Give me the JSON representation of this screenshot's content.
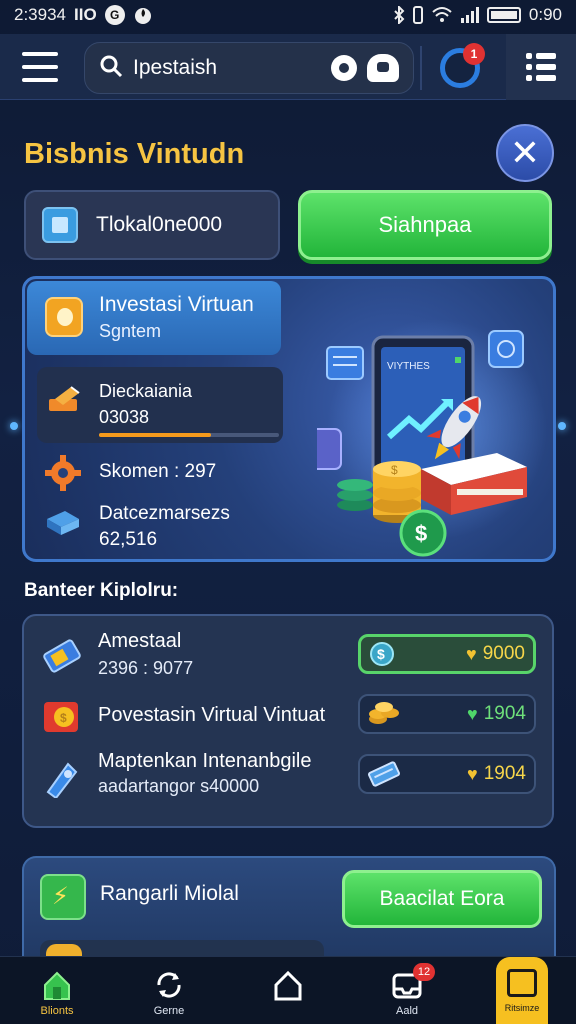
{
  "status_bar": {
    "time": "2:3934",
    "carrier": "ΙΙΟ",
    "app_glyph": "G",
    "battery_text": "0:90"
  },
  "top_bar": {
    "search_value": "Ipestaish",
    "alert_badge": "1"
  },
  "page": {
    "title": "Bisbnis Vintudn"
  },
  "balance": {
    "text": "Tlokal0ne000"
  },
  "primary_button": {
    "label": "Siahnpaa"
  },
  "hero": {
    "title": "Investasi Virtuan",
    "subtitle": "Sgntem",
    "stat_label": "Dieckaiania",
    "stat_value": "03038",
    "progress": 0.62,
    "row1_label": "Skomen : 297",
    "row2_line1": "Datcezmarsezs",
    "row2_line2": "62,516",
    "screen_label": "VIYTHES"
  },
  "section": {
    "label": "Banteer Kiplolru:"
  },
  "list": [
    {
      "name": "Amestaal",
      "sub": "2396 : 9077",
      "amount": "9000",
      "style": "yellow",
      "active": true
    },
    {
      "name": "Povestasin Virtual Vintuat",
      "sub": "",
      "amount": "1904",
      "style": "green",
      "active": false
    },
    {
      "name": "Maptenkan Intenanbgile",
      "sub": "aadartangor s40000",
      "amount": "1904",
      "style": "yellow",
      "active": false
    }
  ],
  "bottom_card": {
    "label": "Rangarli Miolal",
    "button": "Baacilat Eora"
  },
  "bottom_nav": [
    {
      "label": "Blionts",
      "icon": "home-icon",
      "active": true
    },
    {
      "label": "Gerne",
      "icon": "refresh-icon",
      "active": false
    },
    {
      "label": "",
      "icon": "house-outline-icon",
      "active": false
    },
    {
      "label": "Aald",
      "icon": "inbox-icon",
      "active": false,
      "badge": "12"
    },
    {
      "label": "Ritsimze",
      "icon": "wallet-icon",
      "active": false
    }
  ],
  "colors": {
    "accent_yellow": "#f6c442",
    "accent_green": "#22b53a",
    "panel_blue": "#3f78cc",
    "badge_red": "#e03232"
  }
}
